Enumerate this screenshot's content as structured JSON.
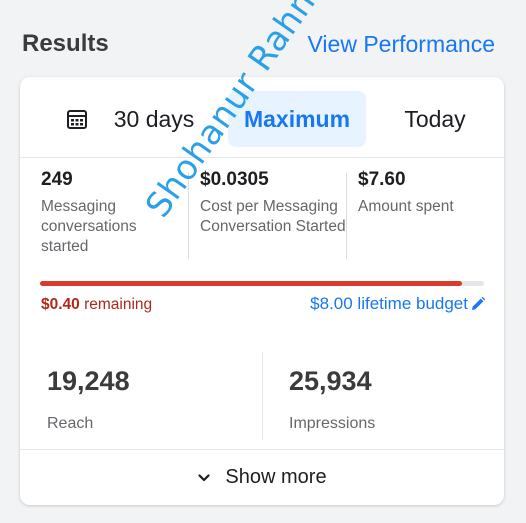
{
  "header": {
    "title": "Results",
    "view_performance": "View Performance"
  },
  "tabs": [
    {
      "label": "30 days",
      "icon": "calendar-icon",
      "selected": false
    },
    {
      "label": "Maximum",
      "selected": true
    },
    {
      "label": "Today",
      "selected": false
    }
  ],
  "metrics": [
    {
      "value": "249",
      "label": "Messaging conversations started"
    },
    {
      "value": "$0.0305",
      "label": "Cost per Messaging Conversation Started"
    },
    {
      "value": "$7.60",
      "label": "Amount spent"
    }
  ],
  "budget": {
    "remaining_amount": "$0.40",
    "remaining_text": "remaining",
    "lifetime_label": "$8.00 lifetime budget",
    "spent_fraction": 0.95,
    "fill_color": "#d93a2b"
  },
  "stats": [
    {
      "value": "19,248",
      "label": "Reach"
    },
    {
      "value": "25,934",
      "label": "Impressions"
    }
  ],
  "show_more": "Show more",
  "watermark": "Shohanur Rahman",
  "colors": {
    "accent": "#1877f2",
    "warning": "#b0281d",
    "selected_tab_bg": "#e7f3ff"
  }
}
